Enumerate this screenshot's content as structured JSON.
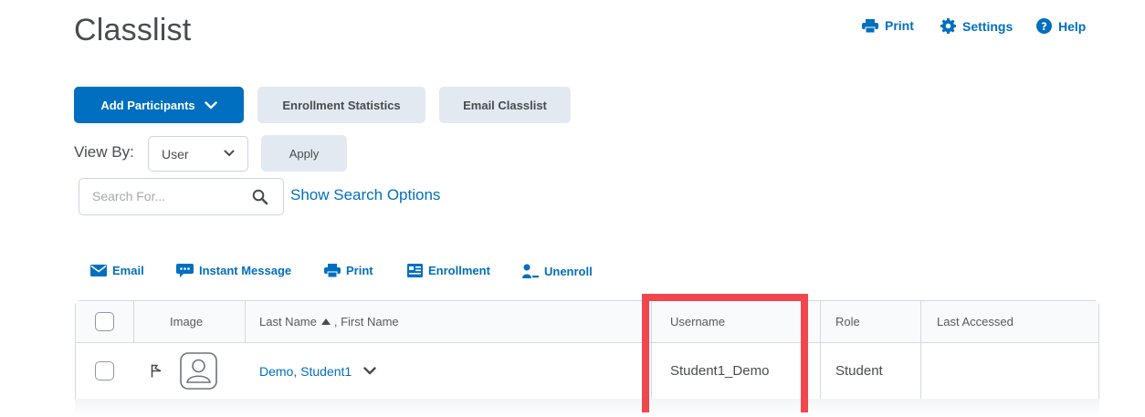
{
  "page": {
    "title": "Classlist"
  },
  "header_links": {
    "print": "Print",
    "settings": "Settings",
    "help": "Help"
  },
  "buttons": {
    "add_participants": "Add Participants",
    "enrollment_statistics": "Enrollment Statistics",
    "email_classlist": "Email Classlist",
    "apply": "Apply"
  },
  "view_by": {
    "label": "View By:",
    "selected": "User"
  },
  "search": {
    "placeholder": "Search For...",
    "show_options": "Show Search Options"
  },
  "actions": {
    "email": "Email",
    "instant_message": "Instant Message",
    "print": "Print",
    "enrollment": "Enrollment",
    "unenroll": "Unenroll"
  },
  "table": {
    "headers": {
      "image": "Image",
      "name": "Last Name",
      "name_suffix": ", First Name",
      "username": "Username",
      "role": "Role",
      "last_accessed": "Last Accessed"
    },
    "rows": [
      {
        "name": "Demo, Student1",
        "username": "Student1_Demo",
        "role": "Student",
        "last_accessed": ""
      }
    ]
  },
  "colors": {
    "accent": "#006fbf",
    "highlight": "#f0474f",
    "button_secondary": "#e3e9f1"
  }
}
